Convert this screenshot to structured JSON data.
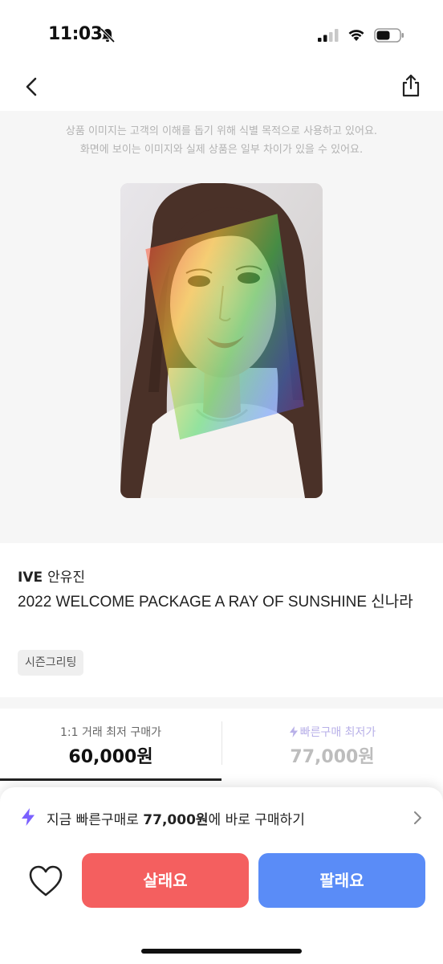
{
  "status_bar": {
    "time": "11:03",
    "icons": [
      "bell-muted-icon",
      "signal-icon",
      "wifi-icon",
      "battery-icon"
    ]
  },
  "header": {
    "back_icon": "chevron-left-icon",
    "share_icon": "share-icon"
  },
  "image_notice": {
    "line1": "상품 이미지는 고객의 이해를 돕기 위해 식별 목적으로 사용하고 있어요.",
    "line2": "화면에 보이는 이미지와 실제 상품은 일부 차이가 있을 수 있어요."
  },
  "product": {
    "artist_group": "IVE",
    "artist_member": "안유진",
    "title": "2022 WELCOME PACKAGE A RAY OF SUNSHINE 신나라",
    "tag": "시즌그리팅"
  },
  "price_tabs": [
    {
      "label": "1:1 거래 최저 구매가",
      "price": "60,000원",
      "selected": true
    },
    {
      "label": "빠른구매 최저가",
      "price": "77,000원",
      "selected": false,
      "icon": "bolt-icon"
    }
  ],
  "quick_buy": {
    "prefix": "지금 빠른구매로",
    "price": "77,000원",
    "suffix": "에 바로 구매하기",
    "icon": "bolt-icon"
  },
  "actions": {
    "buy_label": "살래요",
    "sell_label": "팔래요",
    "like_icon": "heart-outline-icon"
  },
  "colors": {
    "buy": "#f45f5f",
    "sell": "#5a8cf7",
    "bolt": "#7b61ff"
  }
}
